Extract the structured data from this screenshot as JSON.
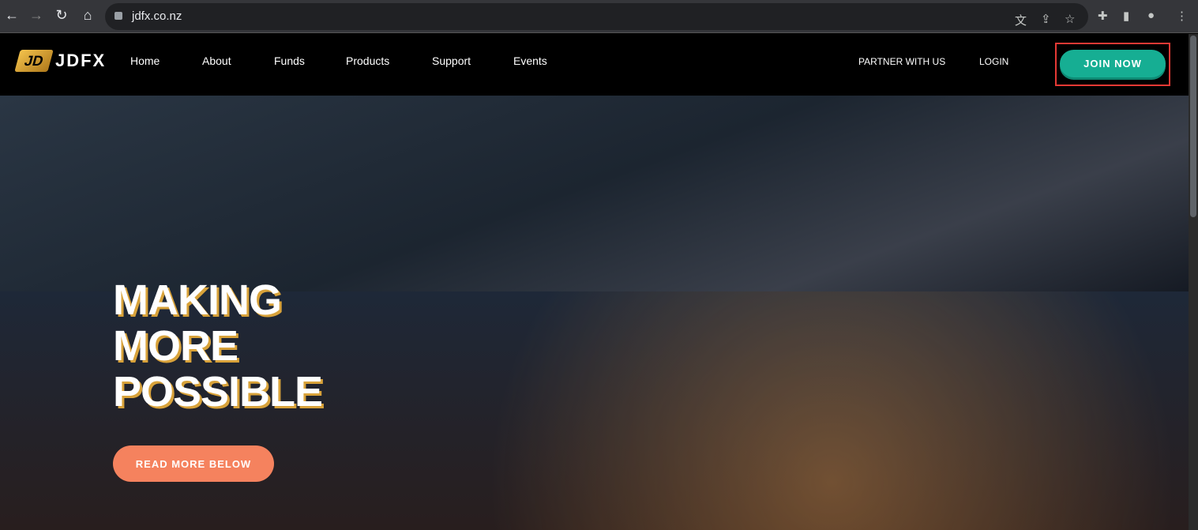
{
  "browser": {
    "url": "jdfx.co.nz"
  },
  "nav": {
    "logo": "JDFX",
    "items": [
      "Home",
      "About",
      "Funds",
      "Products",
      "Support",
      "Events"
    ],
    "partner": "PARTNER WITH US",
    "login": "LOGIN",
    "join": "JOIN NOW"
  },
  "hero": {
    "line1": "MAKING",
    "line2": "MORE",
    "line3": "POSSIBLE",
    "button": "READ MORE BELOW"
  }
}
